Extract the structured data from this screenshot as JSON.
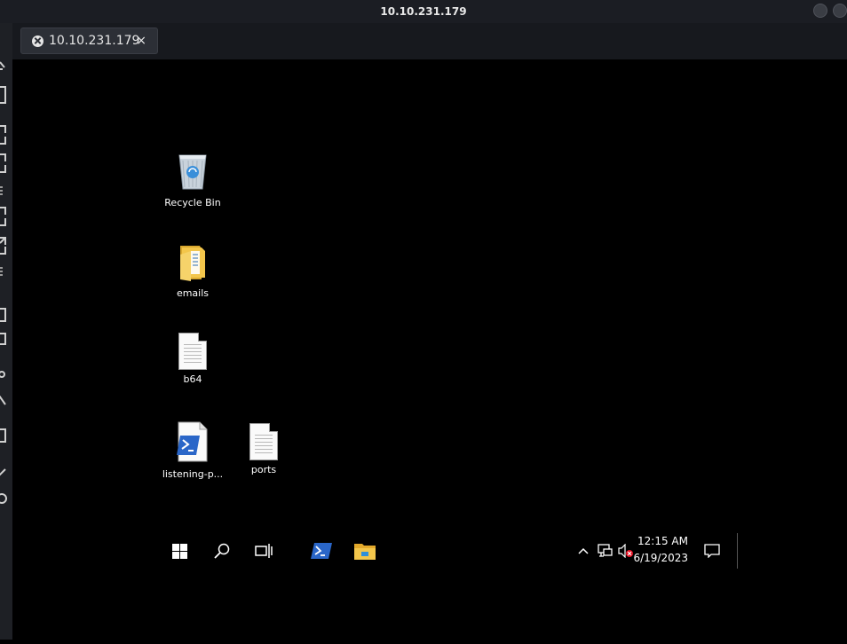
{
  "window": {
    "title": "10.10.231.179"
  },
  "tabs": [
    {
      "label": "10.10.231.179",
      "close_glyph": "×"
    }
  ],
  "desktop": {
    "icons": [
      {
        "label": "Recycle Bin",
        "icon": "recycle-bin-icon"
      },
      {
        "label": "emails",
        "icon": "folder-icon"
      },
      {
        "label": "b64",
        "icon": "text-file-icon"
      },
      {
        "label": "listening-p...",
        "icon": "powershell-script-icon"
      },
      {
        "label": "ports",
        "icon": "text-file-icon"
      }
    ]
  },
  "taskbar": {
    "buttons": [
      {
        "name": "start-button",
        "icon": "windows-logo-icon"
      },
      {
        "name": "search-button",
        "icon": "search-icon"
      },
      {
        "name": "task-view-button",
        "icon": "task-view-icon"
      },
      {
        "name": "powershell-button",
        "icon": "powershell-icon"
      },
      {
        "name": "file-explorer-button",
        "icon": "folder-icon"
      }
    ],
    "tray": {
      "time": "12:15 AM",
      "date": "6/19/2023",
      "icons": [
        "chevron-up-icon",
        "network-icon",
        "volume-muted-icon",
        "notification-icon"
      ]
    }
  },
  "colors": {
    "window_bg": "#1b1d23",
    "tab_bg": "#2c2f36",
    "remote_bg": "#000000",
    "powershell_blue": "#2a66c8",
    "folder_yellow": "#f3c64b"
  }
}
